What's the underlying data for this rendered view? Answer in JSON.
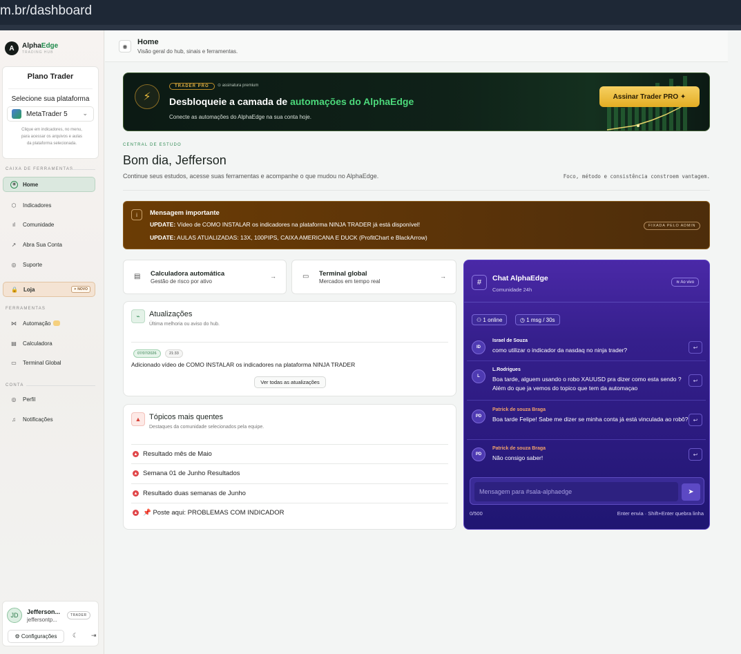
{
  "browser": {
    "url": "m.br/dashboard"
  },
  "brand": {
    "name_prefix": "Alpha",
    "name_accent": "Edge",
    "tagline": "TRADING HUB",
    "mark": "A"
  },
  "plan": {
    "title": "Plano Trader",
    "select_label": "Selecione sua plataforma",
    "platform": "MetaTrader 5",
    "help": "Clique em indicadores, no menu, para acessar os arquivos e aulas da plataforma selecionada."
  },
  "sidebar": {
    "section_tools": "CAIXA DE FERRAMENTAS",
    "items": [
      {
        "label": "Home",
        "icon": "◉"
      },
      {
        "label": "Indicadores",
        "icon": "⬡"
      },
      {
        "label": "Comunidade",
        "icon": "ıl"
      },
      {
        "label": "Abra Sua Conta",
        "icon": "↗"
      },
      {
        "label": "Suporte",
        "icon": "◎"
      }
    ],
    "shop": {
      "label": "Loja",
      "badge": "✦ NOVO",
      "icon": "🔒"
    },
    "section_features": "FERRAMENTAS",
    "features": [
      {
        "label": "Automação",
        "icon": "⋈"
      },
      {
        "label": "Calculadora",
        "icon": "▤"
      },
      {
        "label": "Terminal Global",
        "icon": "▭"
      }
    ],
    "section_account": "CONTA",
    "account": [
      {
        "label": "Perfil",
        "icon": "◎"
      },
      {
        "label": "Notificações",
        "icon": "♫"
      }
    ]
  },
  "user": {
    "initials": "JD",
    "name": "Jefferson...",
    "email": "jeffersontp...",
    "tag": "TRADER",
    "settings": "⚙ Configurações",
    "theme_icon": "☾",
    "logout_icon": "⇥"
  },
  "header": {
    "title": "Home",
    "subtitle": "Visão geral do hub, sinais e ferramentas."
  },
  "promo": {
    "tag": "TRADER PRO",
    "subtag": "⊙ assinatura premium",
    "headline_prefix": "Desbloqueie a camada de ",
    "headline_accent": "automações do AlphaEdge",
    "desc": "Conecte as automações do AlphaEdge na sua conta hoje.",
    "button": "Assinar Trader PRO ✦"
  },
  "study": {
    "eyebrow": "CENTRAL DE ESTUDO",
    "greeting": "Bom dia, Jefferson",
    "subtitle": "Continue seus estudos, acesse suas ferramentas e acompanhe o que mudou no AlphaEdge.",
    "quote": "Foco, método e consistência constroem vantagem."
  },
  "notice": {
    "title": "Mensagem importante",
    "line1_bold": "UPDATE:",
    "line1": " Vídeo de COMO INSTALAR os indicadores na plataforma NINJA TRADER já está disponível!",
    "line2_bold": "UPDATE:",
    "line2": " AULAS ATUALIZADAS: 13X, 100PIPS, CAIXA AMERICANA E DUCK (ProfitChart e BlackArrow)",
    "pinned": "FIXADA PELO ADMIN"
  },
  "quick": [
    {
      "title": "Calculadora automática",
      "subtitle": "Gestão de risco por ativo",
      "icon": "▤",
      "arrow": "→"
    },
    {
      "title": "Terminal global",
      "subtitle": "Mercados em tempo real",
      "icon": "▭",
      "arrow": "→"
    }
  ],
  "updates": {
    "title": "Atualizações",
    "subtitle": "Última melhoria ou aviso do hub.",
    "date": "07/07/2026",
    "time": "21:33",
    "text": "Adicionado vídeo de COMO INSTALAR os indicadores na plataforma NINJA TRADER",
    "button": "Ver todas as atualizações"
  },
  "topics": {
    "title": "Tópicos mais quentes",
    "subtitle": "Destaques da comunidade selecionados pela equipe.",
    "items": [
      "Resultado mês de Maio",
      "Semana 01 de Junho Resultados",
      "Resultado duas semanas de Junho",
      "📌 Poste aqui: PROBLEMAS COM INDICADOR"
    ]
  },
  "chat": {
    "title": "Chat AlphaEdge",
    "subtitle": "Comunidade 24h",
    "live": "Ao vivo",
    "online": "1 online",
    "rate": "1 msg / 30s",
    "messages": [
      {
        "initials": "ID",
        "author": "Israel de Souza",
        "text": "como utilizar o indicador da nasdaq no ninja trader?"
      },
      {
        "initials": "L",
        "author": "L.Rodrigues",
        "text": "Boa tarde, alguem usando o robo XAUUSD pra dizer como esta sendo ? Além do que ja vemos do topico que tem da automaçao"
      },
      {
        "initials": "PD",
        "author": "Patrick de souza Braga",
        "text": "Boa tarde Felipe! Sabe me dizer se minha conta já está vinculada ao robô?"
      },
      {
        "initials": "PD",
        "author": "Patrick de souza Braga",
        "text": "Não consigo saber!"
      }
    ],
    "placeholder": "Mensagem para #sala-alphaedge",
    "counter": "0/500",
    "hint": "Enter envia · Shift+Enter quebra linha"
  }
}
